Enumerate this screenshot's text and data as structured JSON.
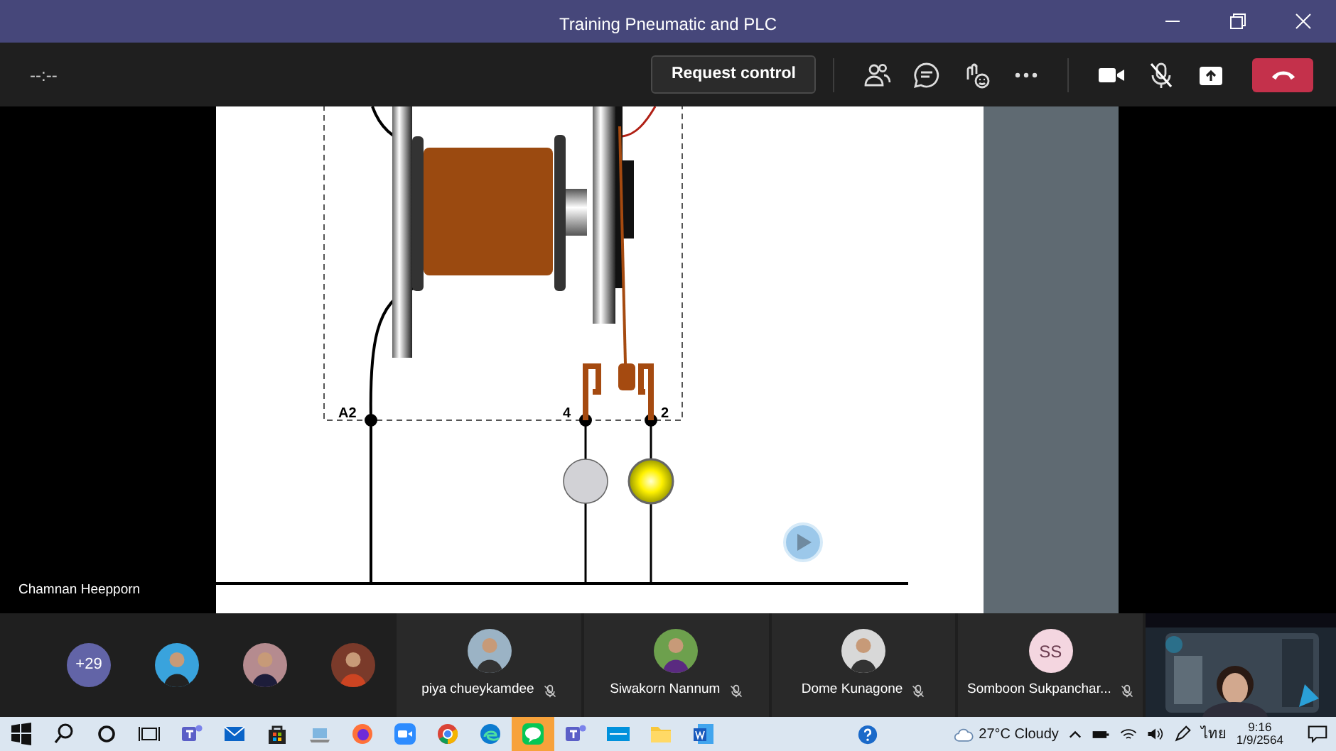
{
  "window": {
    "title": "Training Pneumatic and PLC"
  },
  "call_toolbar": {
    "timer": "--:--",
    "request_button": "Request control",
    "mic_muted": true
  },
  "shared_screen": {
    "presenter": "Chamnan Heepporn",
    "terminals": [
      {
        "label": "A2"
      },
      {
        "label": "4"
      },
      {
        "label": "2"
      }
    ],
    "lamps": [
      {
        "on": false
      },
      {
        "on": true
      }
    ]
  },
  "participants": {
    "overflow": "+29",
    "tiles": [
      {
        "name": "piya chueykamdee",
        "muted": true
      },
      {
        "name": "Siwakorn Nannum",
        "muted": true
      },
      {
        "name": "Dome Kunagone",
        "muted": true
      },
      {
        "kind": "initials",
        "initials": "SS",
        "name": "Somboon Sukpanchar...",
        "muted": true
      }
    ]
  },
  "taskbar": {
    "apps": [
      {
        "kind": "teams",
        "flashing": false
      },
      {
        "kind": "mail",
        "flashing": false
      },
      {
        "kind": "store",
        "flashing": false
      },
      {
        "kind": "laptop",
        "flashing": false
      },
      {
        "kind": "firefox",
        "flashing": false
      },
      {
        "kind": "zoom",
        "flashing": false
      },
      {
        "kind": "chrome",
        "flashing": false
      },
      {
        "kind": "edge",
        "flashing": false
      },
      {
        "kind": "line",
        "flashing": true
      },
      {
        "kind": "teams",
        "flashing": false
      },
      {
        "kind": "festo",
        "flashing": false
      },
      {
        "kind": "folder",
        "flashing": false
      },
      {
        "kind": "word",
        "flashing": false
      }
    ],
    "weather": "27°C Cloudy",
    "language": "ไทย",
    "time": "9:16",
    "date": "1/9/2564"
  }
}
